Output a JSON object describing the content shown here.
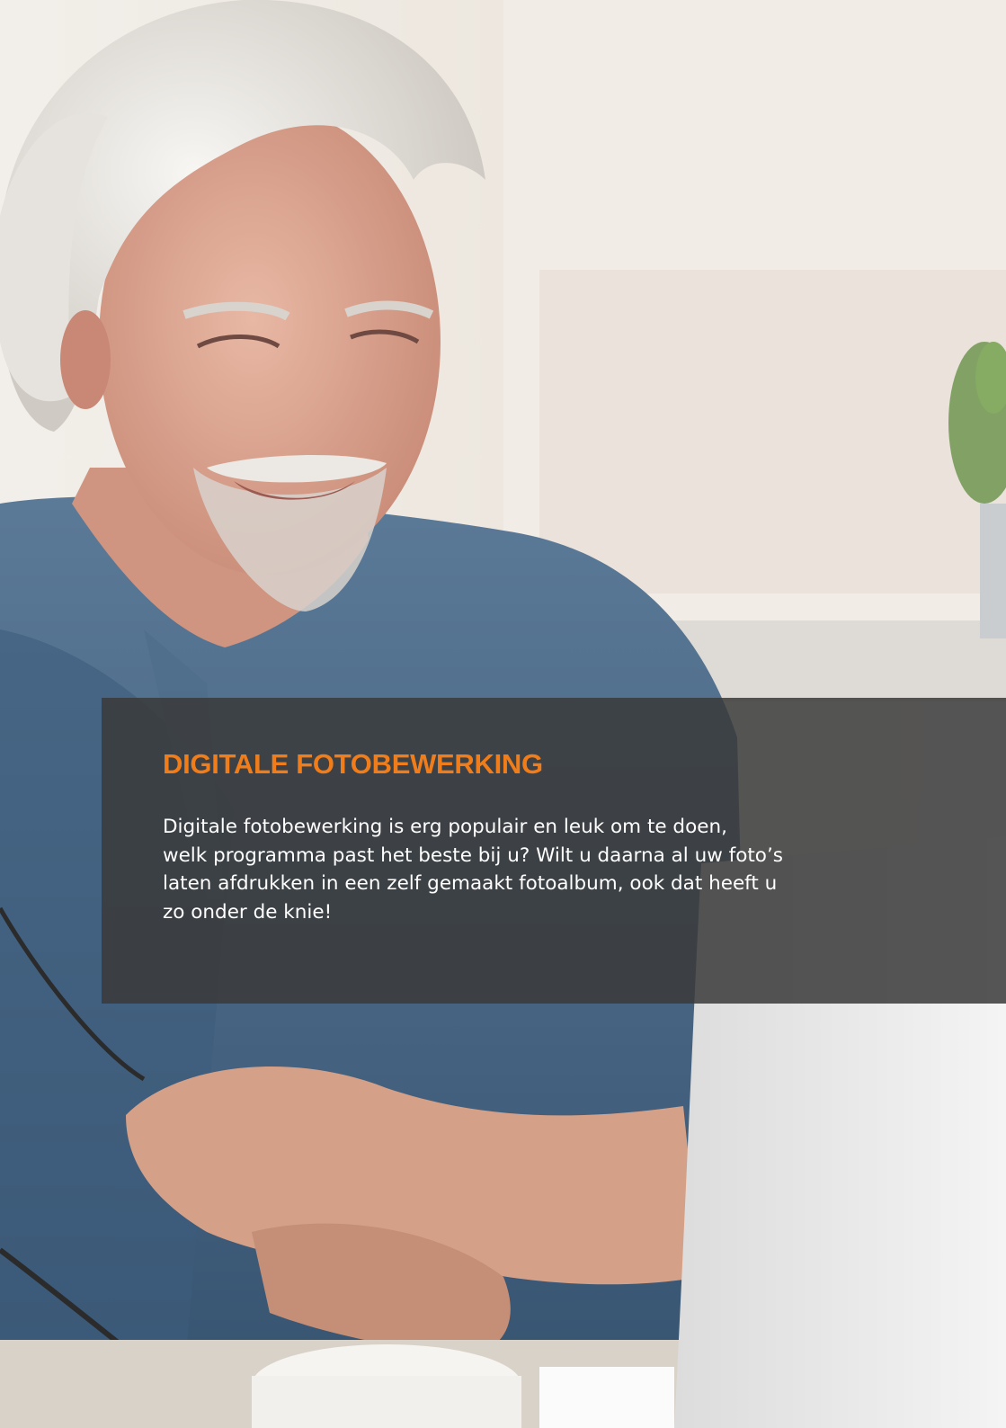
{
  "photo": {
    "icon": "man-at-laptop-photo"
  },
  "colors": {
    "accent": "#f07d1a",
    "panel": "#3a3a3a",
    "text": "#ffffff"
  },
  "section": {
    "title": "DIGITALE FOTOBEWERKING",
    "body_lines": [
      "Digitale fotobewerking is erg populair en leuk om te doen,",
      "welk programma past het beste bij u? Wilt u daarna al uw foto’s",
      "laten afdrukken in een zelf gemaakt fotoalbum, ook dat heeft u",
      "zo onder de knie!"
    ]
  }
}
